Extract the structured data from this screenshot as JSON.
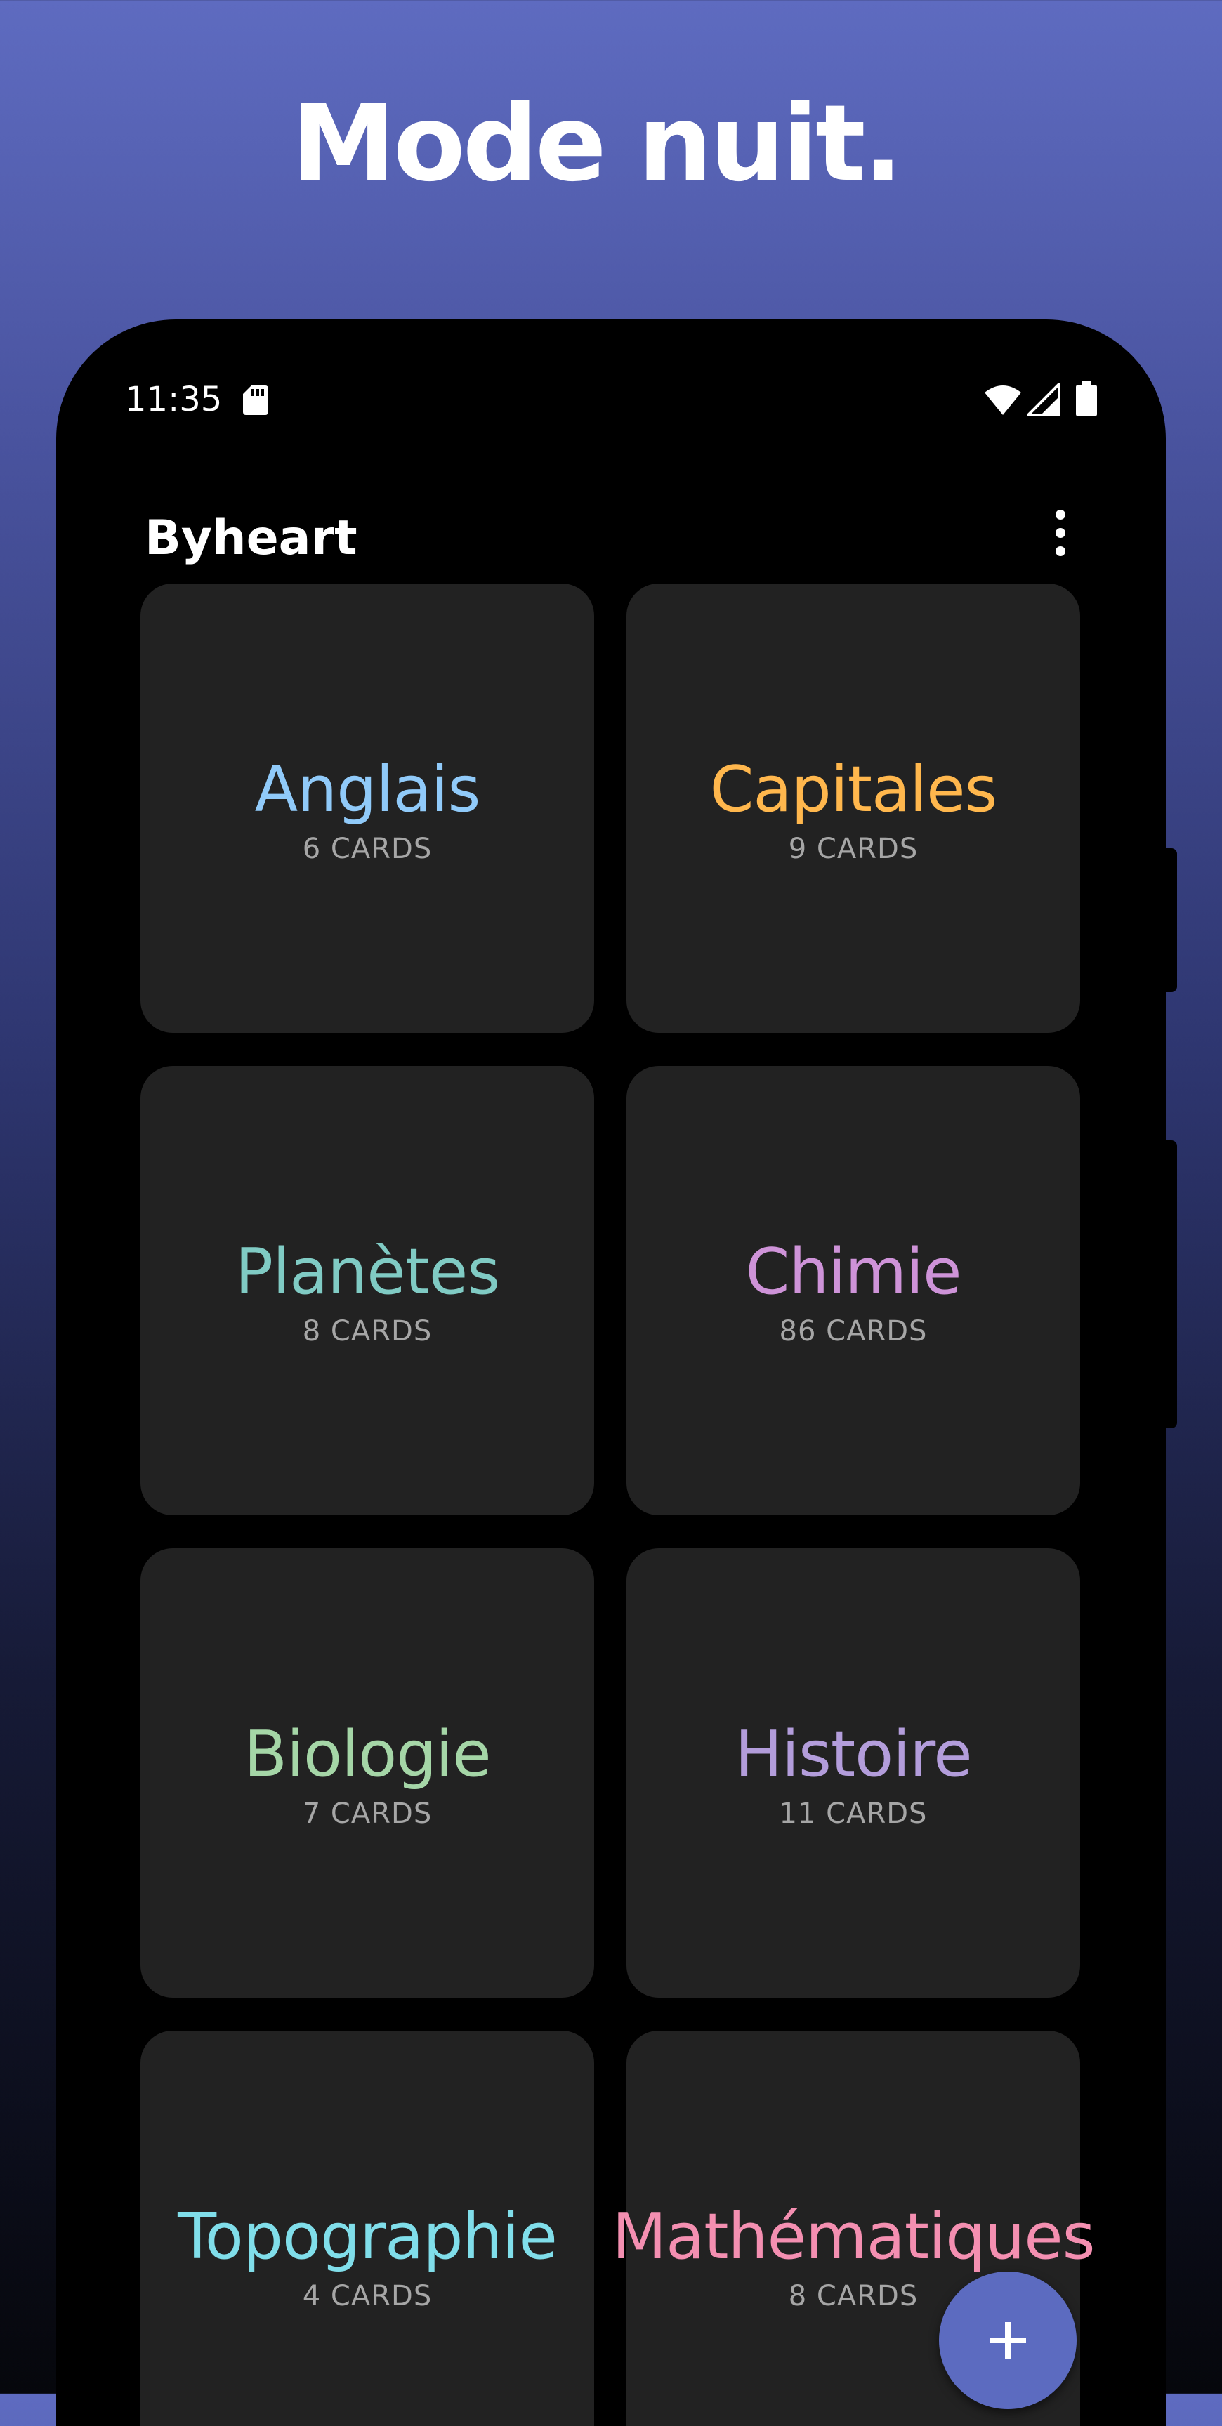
{
  "headline": "Mode nuit.",
  "status_bar": {
    "time": "11:35",
    "icons": [
      "sd-card-icon",
      "wifi-icon",
      "signal-icon",
      "battery-icon"
    ]
  },
  "app_bar": {
    "title": "Byheart",
    "menu_icon": "more-vert-icon"
  },
  "decks": [
    {
      "name": "Anglais",
      "count": "6 CARDS",
      "color": "#90caf9"
    },
    {
      "name": "Capitales",
      "count": "9 CARDS",
      "color": "#ffb74d"
    },
    {
      "name": "Planètes",
      "count": "8 CARDS",
      "color": "#80cbc4"
    },
    {
      "name": "Chimie",
      "count": "86 CARDS",
      "color": "#ce93d8"
    },
    {
      "name": "Biologie",
      "count": "7 CARDS",
      "color": "#a5d6a7"
    },
    {
      "name": "Histoire",
      "count": "11 CARDS",
      "color": "#b39ddb"
    },
    {
      "name": "Topographie",
      "count": "4 CARDS",
      "color": "#80deea"
    },
    {
      "name": "Mathématiques",
      "count": "8 CARDS",
      "color": "#f48fb1"
    }
  ],
  "fab": {
    "icon": "plus-icon",
    "color": "#5c6bc0"
  },
  "colors": {
    "background_top": "#5e6bc0",
    "background_bottom": "#06070c",
    "card": "#222222",
    "count_text": "#a6a6a6"
  }
}
